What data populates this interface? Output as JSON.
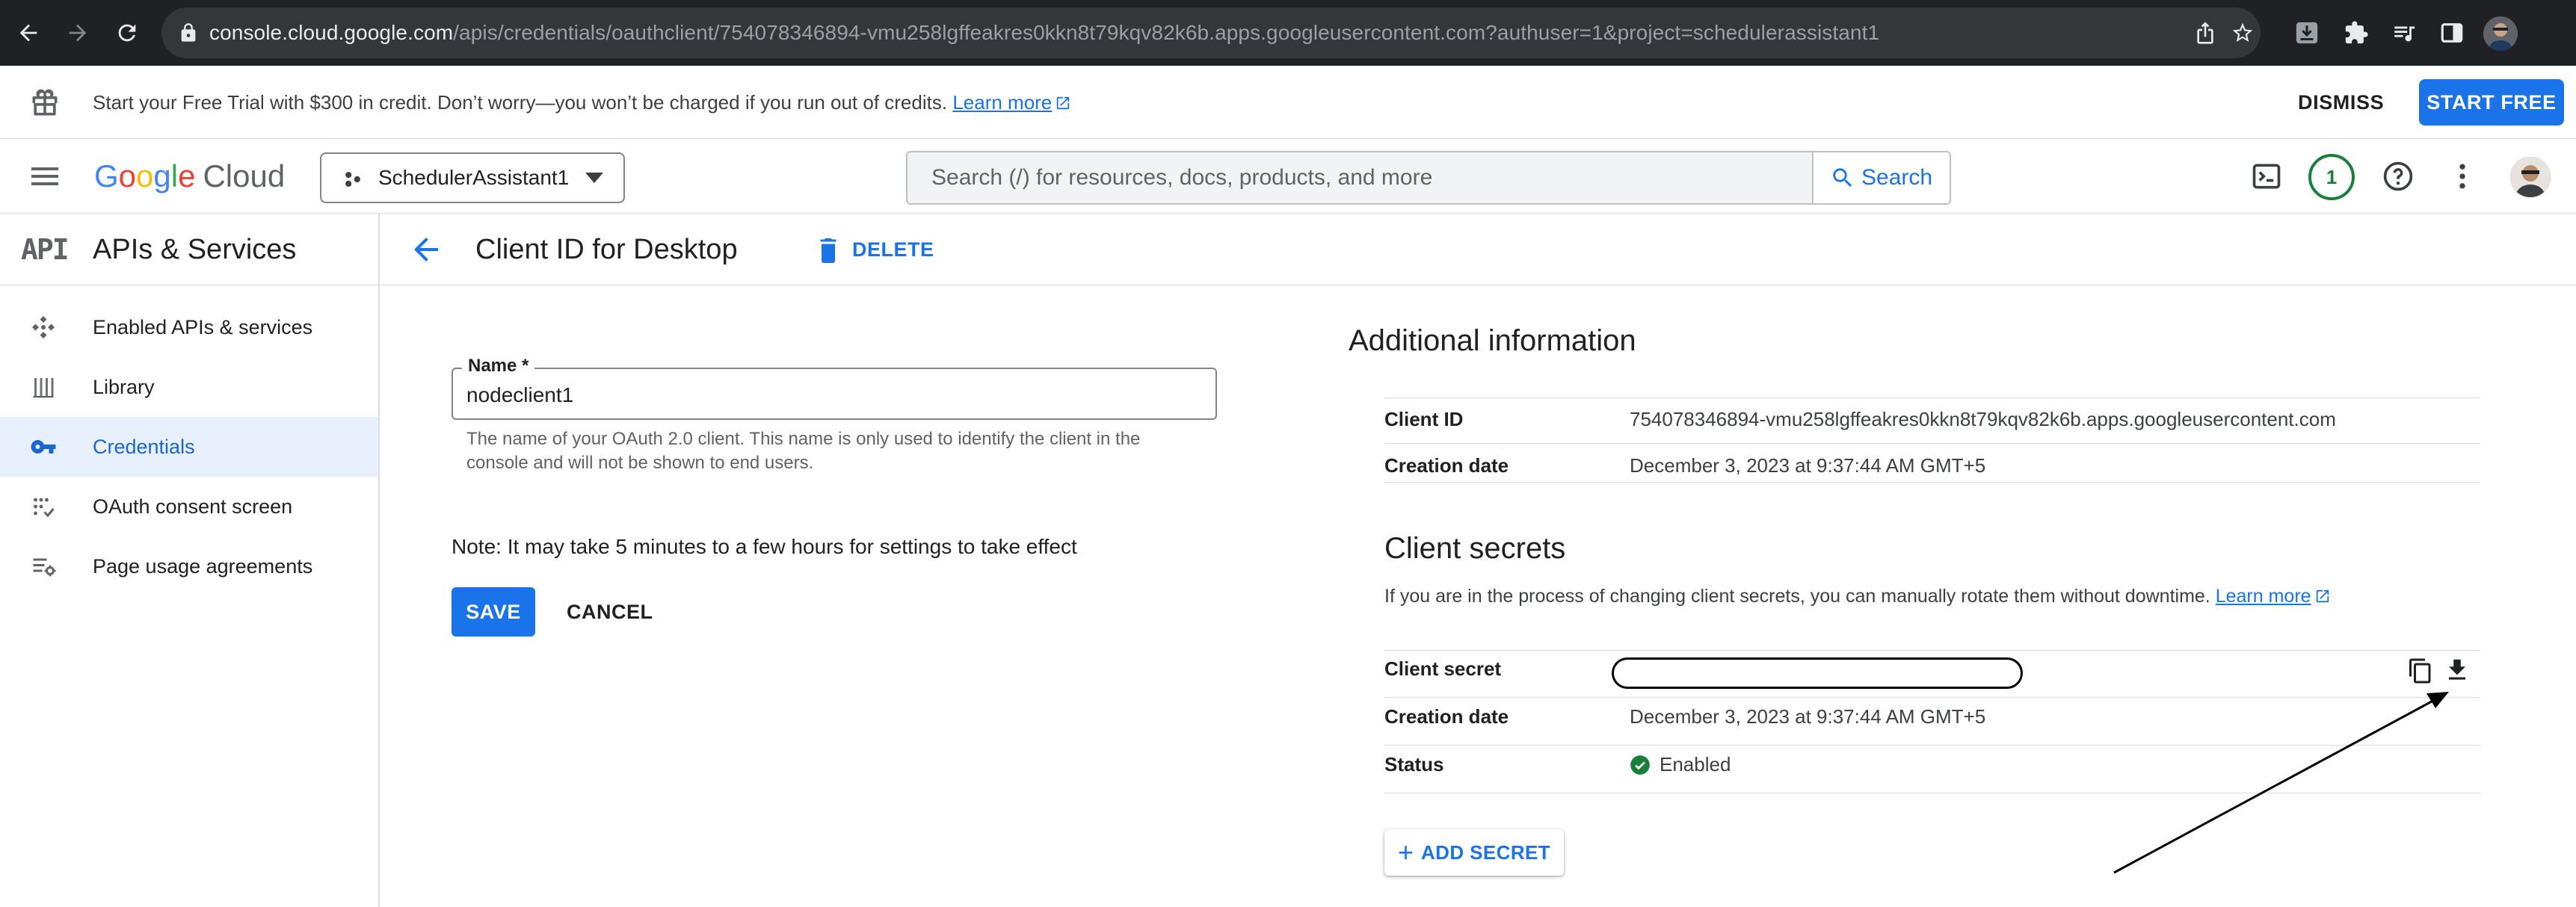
{
  "browser": {
    "url_host": "console.cloud.google.com",
    "url_rest": "/apis/credentials/oauthclient/754078346894-vmu258lgffeakres0kkn8t79kqv82k6b.apps.googleusercontent.com?authuser=1&project=schedulerassistant1"
  },
  "banner": {
    "text": "Start your Free Trial with $300 in credit. Don’t worry—you won’t be charged if you run out of credits.",
    "link": "Learn more",
    "dismiss": "DISMISS",
    "start": "START FREE"
  },
  "header": {
    "logo_google": [
      "G",
      "o",
      "o",
      "g",
      "l",
      "e"
    ],
    "logo_cloud": "Cloud",
    "project": "SchedulerAssistant1",
    "search_placeholder": "Search (/) for resources, docs, products, and more",
    "search_button": "Search",
    "notifications": "1"
  },
  "sidebar": {
    "icon_text": "API",
    "title": "APIs & Services",
    "items": [
      {
        "label": "Enabled APIs & services",
        "icon": "enabled-apis-icon"
      },
      {
        "label": "Library",
        "icon": "library-icon"
      },
      {
        "label": "Credentials",
        "icon": "key-icon",
        "active": true
      },
      {
        "label": "OAuth consent screen",
        "icon": "consent-icon"
      },
      {
        "label": "Page usage agreements",
        "icon": "settings-list-icon"
      }
    ]
  },
  "page": {
    "title": "Client ID for Desktop",
    "delete": "DELETE"
  },
  "form": {
    "name_label": "Name *",
    "name_value": "nodeclient1",
    "hint": "The name of your OAuth 2.0 client. This name is only used to identify the client in the console and will not be shown to end users.",
    "note": "Note: It may take 5 minutes to a few hours for settings to take effect",
    "save": "SAVE",
    "cancel": "CANCEL"
  },
  "info": {
    "title": "Additional information",
    "client_id_label": "Client ID",
    "client_id_value": "754078346894-vmu258lgffeakres0kkn8t79kqv82k6b.apps.googleusercontent.com",
    "creation_label": "Creation date",
    "creation_value": "December 3, 2023 at 9:37:44 AM GMT+5"
  },
  "secrets": {
    "title": "Client secrets",
    "desc": "If you are in the process of changing client secrets, you can manually rotate them without downtime.",
    "link": "Learn more",
    "secret_label": "Client secret",
    "creation_label": "Creation date",
    "creation_value": "December 3, 2023 at 9:37:44 AM GMT+5",
    "status_label": "Status",
    "status_value": "Enabled",
    "add_secret": "ADD SECRET"
  },
  "colors": {
    "accent": "#1a73e8",
    "active_bg": "#e8f0fe",
    "success": "#188038",
    "chrome_bg": "#202124"
  }
}
